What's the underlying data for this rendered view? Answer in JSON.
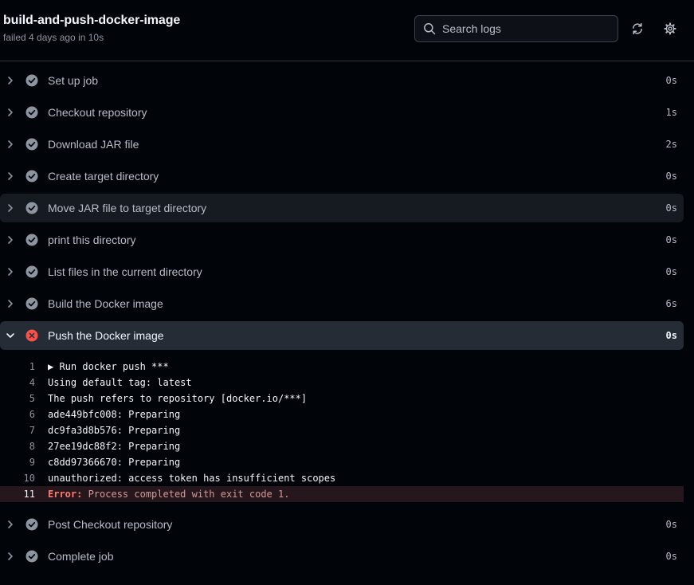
{
  "header": {
    "title": "build-and-push-docker-image",
    "subtitle": "failed 4 days ago in 10s"
  },
  "search": {
    "placeholder": "Search logs"
  },
  "icons": {
    "refresh": "sync-icon",
    "settings": "gear-icon"
  },
  "colors": {
    "success": "#8d96a0",
    "failure": "#f85149",
    "error_label": "#ff7b72"
  },
  "steps_before": [
    {
      "name": "Set up job",
      "duration": "0s"
    },
    {
      "name": "Checkout repository",
      "duration": "1s"
    },
    {
      "name": "Download JAR file",
      "duration": "2s"
    },
    {
      "name": "Create target directory",
      "duration": "0s"
    },
    {
      "name": "Move JAR file to target directory",
      "duration": "0s"
    },
    {
      "name": "print this directory",
      "duration": "0s"
    },
    {
      "name": "List files in the current directory",
      "duration": "0s"
    },
    {
      "name": "Build the Docker image",
      "duration": "6s"
    }
  ],
  "failed_step": {
    "name": "Push the Docker image",
    "duration": "0s"
  },
  "log_lines": [
    {
      "num": "1",
      "text": "▶ Run docker push ***"
    },
    {
      "num": "4",
      "text": "Using default tag: latest"
    },
    {
      "num": "5",
      "text": "The push refers to repository [docker.io/***]"
    },
    {
      "num": "6",
      "text": "ade449bfc008: Preparing"
    },
    {
      "num": "7",
      "text": "dc9fa3d8b576: Preparing"
    },
    {
      "num": "8",
      "text": "27ee19dc88f2: Preparing"
    },
    {
      "num": "9",
      "text": "c8dd97366670: Preparing"
    },
    {
      "num": "10",
      "text": "unauthorized: access token has insufficient scopes"
    }
  ],
  "error_line": {
    "num": "11",
    "label": "Error:",
    "text": " Process completed with exit code 1."
  },
  "steps_after": [
    {
      "name": "Post Checkout repository",
      "duration": "0s"
    },
    {
      "name": "Complete job",
      "duration": "0s"
    }
  ]
}
